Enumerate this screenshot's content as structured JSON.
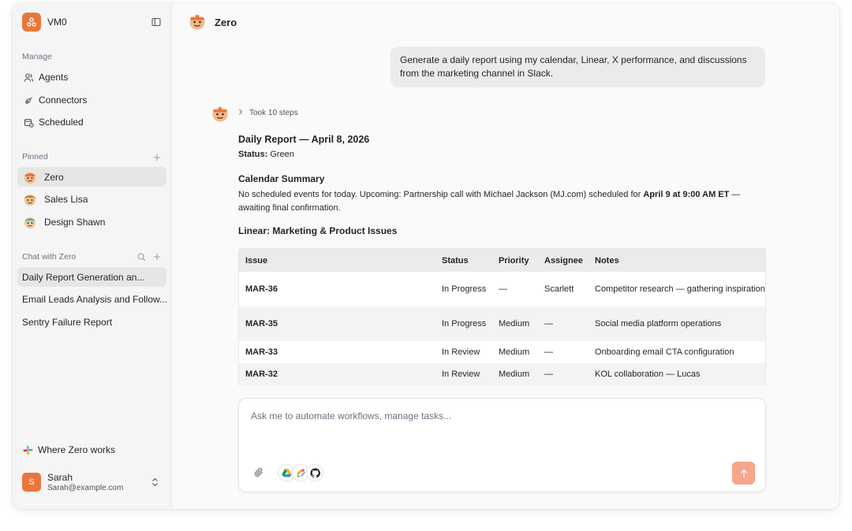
{
  "app": {
    "workspace_name": "VM0",
    "accent": "#e9773a"
  },
  "sidebar": {
    "manage_label": "Manage",
    "manage_items": [
      {
        "label": "Agents",
        "icon": "users-icon"
      },
      {
        "label": "Connectors",
        "icon": "plug-icon"
      },
      {
        "label": "Scheduled",
        "icon": "calendar-icon"
      }
    ],
    "pinned_label": "Pinned",
    "pinned_items": [
      {
        "label": "Zero",
        "active": true
      },
      {
        "label": "Sales Lisa",
        "active": false
      },
      {
        "label": "Design Shawn",
        "active": false
      }
    ],
    "chat_label": "Chat with Zero",
    "chats": [
      {
        "label": "Daily Report Generation an...",
        "active": true
      },
      {
        "label": "Email Leads Analysis and Follow...",
        "active": false
      },
      {
        "label": "Sentry Failure Report",
        "active": false
      }
    ],
    "where_label": "Where Zero works",
    "user": {
      "initial": "S",
      "name": "Sarah",
      "email": "Sarah@example.com"
    }
  },
  "main": {
    "agent_name": "Zero",
    "user_message": "Generate a daily report using my calendar, Linear, X performance, and discussions from the marketing channel in Slack.",
    "steps_label": "Took 10 steps",
    "report": {
      "title": "Daily Report — April 8, 2026",
      "status_label": "Status:",
      "status_value": "Green",
      "calendar_heading": "Calendar Summary",
      "calendar_text_a": "No scheduled events for today. Upcoming: Partnership call with Michael Jackson (MJ.com) scheduled for ",
      "calendar_text_bold": "April 9 at 9:00 AM ET",
      "calendar_text_b": " — awaiting final confirmation.",
      "linear_heading": "Linear: Marketing & Product Issues",
      "table": {
        "headers": [
          "Issue",
          "Status",
          "Priority",
          "Assignee",
          "Notes"
        ],
        "rows": [
          [
            "MAR-36",
            "In Progress",
            "—",
            "Scarlett",
            "Competitor research — gathering inspiration"
          ],
          [
            "MAR-35",
            "In Progress",
            "Medium",
            "—",
            "Social media platform operations"
          ],
          [
            "MAR-33",
            "In Review",
            "Medium",
            "—",
            "Onboarding email CTA configuration"
          ],
          [
            "MAR-32",
            "In Review",
            "Medium",
            "—",
            "KOL collaboration — Lucas"
          ]
        ]
      }
    },
    "composer": {
      "placeholder": "Ask me to automate workflows, manage tasks...",
      "value": "",
      "integrations": [
        "google-drive-icon",
        "multi-app-icon",
        "github-icon"
      ]
    }
  }
}
